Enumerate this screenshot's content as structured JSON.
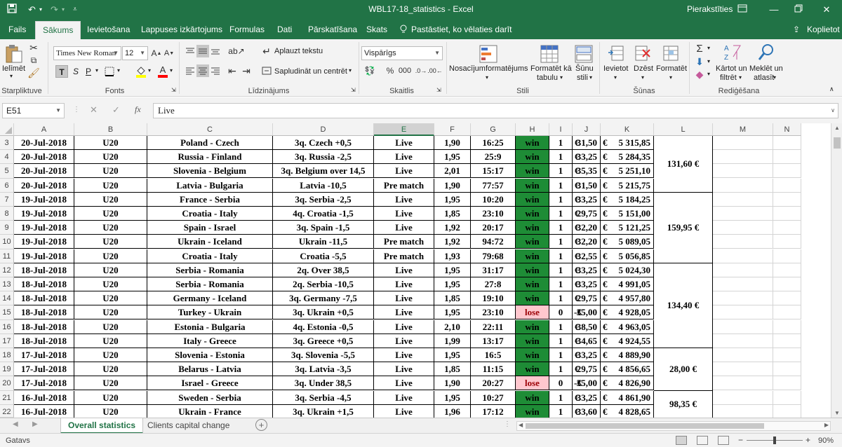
{
  "window": {
    "title": "WBL17-18_statistics  -  Excel",
    "signin": "Pierakstīties",
    "share": "Koplietot"
  },
  "ribbon_tabs": [
    "Fails",
    "Sākums",
    "Ievietošana",
    "Lappuses izkārtojums",
    "Formulas",
    "Dati",
    "Pārskatīšana",
    "Skats"
  ],
  "tell_me": "Pastāstiet, ko vēlaties darīt",
  "ribbon": {
    "paste_label": "Ielīmēt",
    "clipboard_label": "Starpliktuve",
    "font_name": "Times New Roman",
    "font_size": "12",
    "font_label": "Fonts",
    "bold": "T",
    "italic": "S",
    "underline": "P",
    "wrap_text": "Aplauzt tekstu",
    "merge_center": "Sapludināt un centrēt",
    "alignment_label": "Līdzinājums",
    "number_format": "Vispārīgs",
    "number_label": "Skaitlis",
    "conditional_format": "Nosacījumformatējums",
    "format_as_table": [
      "Formatēt kā",
      "tabulu"
    ],
    "cell_styles": [
      "Šūnu",
      "stili"
    ],
    "styles_label": "Stili",
    "insert": "Ievietot",
    "delete": "Dzēst",
    "format": "Formatēt",
    "cells_label": "Šūnas",
    "sort_filter": [
      "Kārtot un",
      "filtrēt"
    ],
    "find_select": [
      "Meklēt un",
      "atlasīt"
    ],
    "editing_label": "Rediģēšana"
  },
  "formula_bar": {
    "name_box": "E51",
    "formula": "Live"
  },
  "columns": [
    "A",
    "B",
    "C",
    "D",
    "E",
    "F",
    "G",
    "H",
    "I",
    "J",
    "K",
    "L",
    "M",
    "N"
  ],
  "selected_column": "E",
  "rows": [
    {
      "n": "3",
      "date": "20-Jul-2018",
      "cat": "U20",
      "match": "Poland - Czech",
      "bet": "3q. Czech +0,5",
      "type": "Live",
      "odds": "1,90",
      "time": "16:25",
      "result": "win",
      "flag": "1",
      "cur": "€",
      "amount": "31,50",
      "kcur": "€",
      "balance": "5 315,85"
    },
    {
      "n": "4",
      "date": "20-Jul-2018",
      "cat": "U20",
      "match": "Russia - Finland",
      "bet": "3q. Russia -2,5",
      "type": "Live",
      "odds": "1,95",
      "time": "25:9",
      "result": "win",
      "flag": "1",
      "cur": "€",
      "amount": "33,25",
      "kcur": "€",
      "balance": "5 284,35"
    },
    {
      "n": "5",
      "date": "20-Jul-2018",
      "cat": "U20",
      "match": "Slovenia - Belgium",
      "bet": "3q. Belgium over 14,5",
      "type": "Live",
      "odds": "2,01",
      "time": "15:17",
      "result": "win",
      "flag": "1",
      "cur": "€",
      "amount": "35,35",
      "kcur": "€",
      "balance": "5 251,10"
    },
    {
      "n": "6",
      "date": "20-Jul-2018",
      "cat": "U20",
      "match": "Latvia - Bulgaria",
      "bet": "Latvia -10,5",
      "type": "Pre match",
      "odds": "1,90",
      "time": "77:57",
      "result": "win",
      "flag": "1",
      "cur": "€",
      "amount": "31,50",
      "kcur": "€",
      "balance": "5 215,75"
    },
    {
      "n": "7",
      "date": "19-Jul-2018",
      "cat": "U20",
      "match": "France - Serbia",
      "bet": "3q. Serbia -2,5",
      "type": "Live",
      "odds": "1,95",
      "time": "10:20",
      "result": "win",
      "flag": "1",
      "cur": "€",
      "amount": "33,25",
      "kcur": "€",
      "balance": "5 184,25"
    },
    {
      "n": "8",
      "date": "19-Jul-2018",
      "cat": "U20",
      "match": "Croatia - Italy",
      "bet": "4q. Croatia -1,5",
      "type": "Live",
      "odds": "1,85",
      "time": "23:10",
      "result": "win",
      "flag": "1",
      "cur": "€",
      "amount": "29,75",
      "kcur": "€",
      "balance": "5 151,00"
    },
    {
      "n": "9",
      "date": "19-Jul-2018",
      "cat": "U20",
      "match": "Spain - Israel",
      "bet": "3q. Spain -1,5",
      "type": "Live",
      "odds": "1,92",
      "time": "20:17",
      "result": "win",
      "flag": "1",
      "cur": "€",
      "amount": "32,20",
      "kcur": "€",
      "balance": "5 121,25"
    },
    {
      "n": "10",
      "date": "19-Jul-2018",
      "cat": "U20",
      "match": "Ukrain - Iceland",
      "bet": "Ukrain -11,5",
      "type": "Pre match",
      "odds": "1,92",
      "time": "94:72",
      "result": "win",
      "flag": "1",
      "cur": "€",
      "amount": "32,20",
      "kcur": "€",
      "balance": "5 089,05"
    },
    {
      "n": "11",
      "date": "19-Jul-2018",
      "cat": "U20",
      "match": "Croatia - Italy",
      "bet": "Croatia -5,5",
      "type": "Pre match",
      "odds": "1,93",
      "time": "79:68",
      "result": "win",
      "flag": "1",
      "cur": "€",
      "amount": "32,55",
      "kcur": "€",
      "balance": "5 056,85"
    },
    {
      "n": "12",
      "date": "18-Jul-2018",
      "cat": "U20",
      "match": "Serbia - Romania",
      "bet": "2q. Over 38,5",
      "type": "Live",
      "odds": "1,95",
      "time": "31:17",
      "result": "win",
      "flag": "1",
      "cur": "€",
      "amount": "33,25",
      "kcur": "€",
      "balance": "5 024,30"
    },
    {
      "n": "13",
      "date": "18-Jul-2018",
      "cat": "U20",
      "match": "Serbia - Romania",
      "bet": "2q. Serbia -10,5",
      "type": "Live",
      "odds": "1,95",
      "time": "27:8",
      "result": "win",
      "flag": "1",
      "cur": "€",
      "amount": "33,25",
      "kcur": "€",
      "balance": "4 991,05"
    },
    {
      "n": "14",
      "date": "18-Jul-2018",
      "cat": "U20",
      "match": "Germany - Iceland",
      "bet": "3q. Germany -7,5",
      "type": "Live",
      "odds": "1,85",
      "time": "19:10",
      "result": "win",
      "flag": "1",
      "cur": "€",
      "amount": "29,75",
      "kcur": "€",
      "balance": "4 957,80"
    },
    {
      "n": "15",
      "date": "18-Jul-2018",
      "cat": "U20",
      "match": "Turkey - Ukrain",
      "bet": "3q. Ukrain +0,5",
      "type": "Live",
      "odds": "1,95",
      "time": "23:10",
      "result": "lose",
      "flag": "0",
      "cur": "-€",
      "amount": "35,00",
      "kcur": "€",
      "balance": "4 928,05"
    },
    {
      "n": "16",
      "date": "18-Jul-2018",
      "cat": "U20",
      "match": "Estonia - Bulgaria",
      "bet": "4q. Estonia -0,5",
      "type": "Live",
      "odds": "2,10",
      "time": "22:11",
      "result": "win",
      "flag": "1",
      "cur": "€",
      "amount": "38,50",
      "kcur": "€",
      "balance": "4 963,05"
    },
    {
      "n": "17",
      "date": "18-Jul-2018",
      "cat": "U20",
      "match": "Italy - Greece",
      "bet": "3q. Greece +0,5",
      "type": "Live",
      "odds": "1,99",
      "time": "13:17",
      "result": "win",
      "flag": "1",
      "cur": "€",
      "amount": "34,65",
      "kcur": "€",
      "balance": "4 924,55"
    },
    {
      "n": "18",
      "date": "17-Jul-2018",
      "cat": "U20",
      "match": "Slovenia - Estonia",
      "bet": "3q. Slovenia -5,5",
      "type": "Live",
      "odds": "1,95",
      "time": "16:5",
      "result": "win",
      "flag": "1",
      "cur": "€",
      "amount": "33,25",
      "kcur": "€",
      "balance": "4 889,90"
    },
    {
      "n": "19",
      "date": "17-Jul-2018",
      "cat": "U20",
      "match": "Belarus - Latvia",
      "bet": "3q. Latvia -3,5",
      "type": "Live",
      "odds": "1,85",
      "time": "11:15",
      "result": "win",
      "flag": "1",
      "cur": "€",
      "amount": "29,75",
      "kcur": "€",
      "balance": "4 856,65"
    },
    {
      "n": "20",
      "date": "17-Jul-2018",
      "cat": "U20",
      "match": "Israel - Greece",
      "bet": "3q. Under 38,5",
      "type": "Live",
      "odds": "1,90",
      "time": "20:27",
      "result": "lose",
      "flag": "0",
      "cur": "-€",
      "amount": "35,00",
      "kcur": "€",
      "balance": "4 826,90"
    },
    {
      "n": "21",
      "date": "16-Jul-2018",
      "cat": "U20",
      "match": "Sweden - Serbia",
      "bet": "3q. Serbia -4,5",
      "type": "Live",
      "odds": "1,95",
      "time": "10:27",
      "result": "win",
      "flag": "1",
      "cur": "€",
      "amount": "33,25",
      "kcur": "€",
      "balance": "4 861,90"
    },
    {
      "n": "22",
      "date": "16-Jul-2018",
      "cat": "U20",
      "match": "Ukrain - France",
      "bet": "3q. Ukrain +1,5",
      "type": "Live",
      "odds": "1,96",
      "time": "17:12",
      "result": "win",
      "flag": "1",
      "cur": "€",
      "amount": "33,60",
      "kcur": "€",
      "balance": "4 828,65"
    }
  ],
  "daily_totals": [
    {
      "rows": "3-6",
      "value": "131,60 €"
    },
    {
      "rows": "7-11",
      "value": "159,95 €"
    },
    {
      "rows": "12-17",
      "value": "134,40 €"
    },
    {
      "rows": "18-20",
      "value": "28,00 €"
    },
    {
      "rows": "21-22",
      "value": "98,35 €"
    }
  ],
  "sheets": [
    "Overall statistics",
    "Clients capital change"
  ],
  "active_sheet": "Overall statistics",
  "status": {
    "mode": "Gatavs",
    "zoom": "90%"
  },
  "colors": {
    "excel_green": "#217346",
    "win_fill": "#1e8c36",
    "lose_fill": "#ffc7ce",
    "lose_text": "#9c0006"
  }
}
